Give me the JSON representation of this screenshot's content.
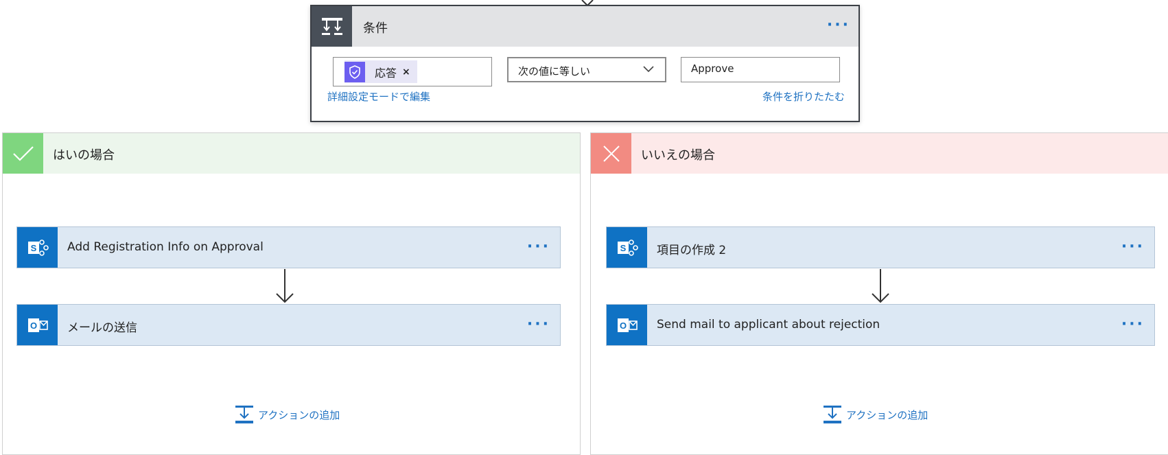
{
  "condition": {
    "title": "条件",
    "token_label": "応答",
    "token_close": "×",
    "operator": "次の値に等しい",
    "value": "Approve",
    "advanced_mode_link": "詳細設定モードで編集",
    "collapse_link": "条件を折りたたむ",
    "more": "···"
  },
  "branches": {
    "yes": {
      "title": "はいの場合",
      "actions": [
        {
          "label": "Add Registration Info on Approval",
          "icon": "sharepoint-icon",
          "more": "···"
        },
        {
          "label": "メールの送信",
          "icon": "outlook-icon",
          "more": "···"
        }
      ],
      "add_action": "アクションの追加"
    },
    "no": {
      "title": "いいえの場合",
      "actions": [
        {
          "label": "項目の作成 2",
          "icon": "sharepoint-icon",
          "more": "···"
        },
        {
          "label": "Send mail to applicant about rejection",
          "icon": "outlook-icon",
          "more": "···"
        }
      ],
      "add_action": "アクションの追加"
    }
  },
  "colors": {
    "accent": "#1f72c2",
    "yes": "#7fd67f",
    "no": "#f28b82",
    "condition_header": "#484f58"
  }
}
